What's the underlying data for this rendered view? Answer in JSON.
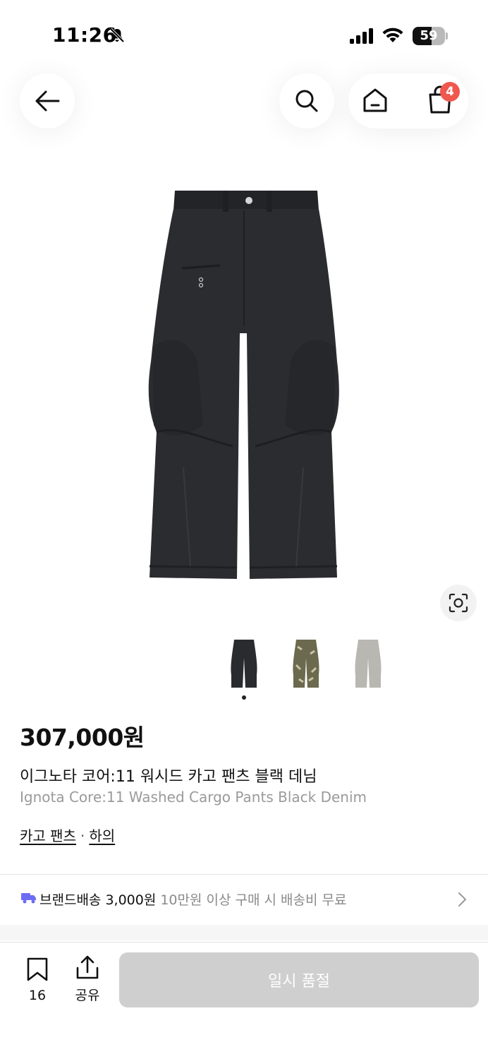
{
  "status_bar": {
    "time": "11:26",
    "battery": "59",
    "battery_level": 0.59
  },
  "nav": {
    "cart_badge": "4"
  },
  "gallery": {
    "current_index": 0,
    "thumbnails": [
      {
        "name": "black",
        "color": "#2a2b2f"
      },
      {
        "name": "camo",
        "color": "#6b6a4e"
      },
      {
        "name": "grey",
        "color": "#b9b7b2"
      }
    ]
  },
  "product": {
    "price": "307,000원",
    "name_ko": "이그노타 코어:11 워시드 카고 팬츠 블랙 데님",
    "name_en": "Ignota Core:11 Washed Cargo Pants Black Denim",
    "categories": [
      "카고 팬츠",
      "하의"
    ],
    "separator": "·"
  },
  "shipping": {
    "label": "브랜드배송 3,000원",
    "note": "10만원 이상 구매 시 배송비 무료"
  },
  "bottom_bar": {
    "bookmark_count": "16",
    "share_label": "공유",
    "cta_label": "일시 품절"
  },
  "colors": {
    "accent_truck": "#6c6cf5",
    "badge": "#f0574f",
    "cta_disabled": "#cfcfcf"
  }
}
